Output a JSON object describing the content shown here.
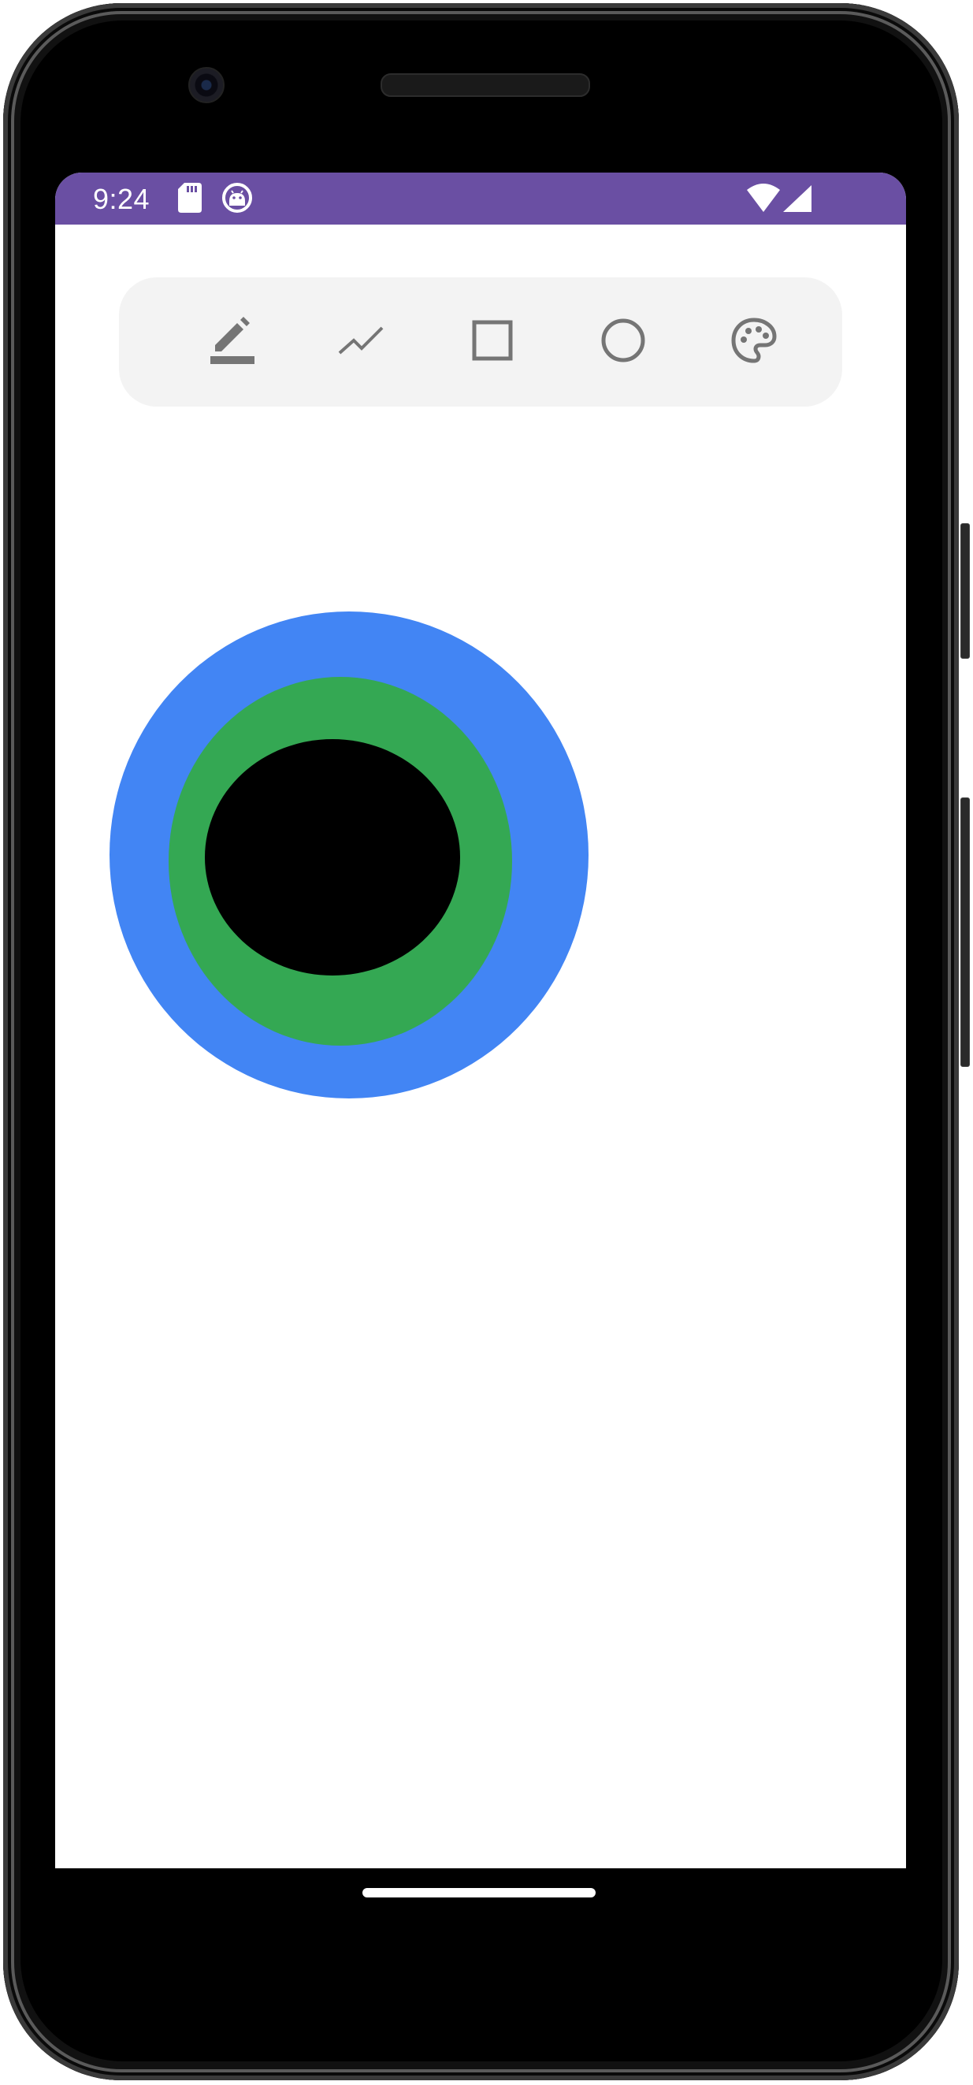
{
  "status_bar": {
    "time": "9:24",
    "background": "#6a4fa3",
    "icons_left": [
      "sd-card-icon",
      "android-debug-icon"
    ],
    "icons_right": [
      "wifi-icon",
      "cell-signal-icon"
    ]
  },
  "toolbar": {
    "tools": [
      {
        "name": "pen-tool",
        "icon": "edit-pencil-icon"
      },
      {
        "name": "line-tool",
        "icon": "polyline-icon"
      },
      {
        "name": "rectangle-tool",
        "icon": "square-outline-icon"
      },
      {
        "name": "circle-tool",
        "icon": "circle-outline-icon"
      },
      {
        "name": "color-tool",
        "icon": "palette-icon"
      }
    ],
    "icon_color": "#757575",
    "background": "#f3f3f3"
  },
  "canvas": {
    "shapes": [
      {
        "type": "ellipse",
        "fill": "#4285f4",
        "label": "outer-blue-ellipse"
      },
      {
        "type": "ellipse",
        "fill": "#34a853",
        "label": "middle-green-ellipse"
      },
      {
        "type": "ellipse",
        "fill": "#000000",
        "label": "inner-black-ellipse"
      }
    ]
  },
  "navigation": {
    "gesture_bar": "home-gesture-bar"
  }
}
